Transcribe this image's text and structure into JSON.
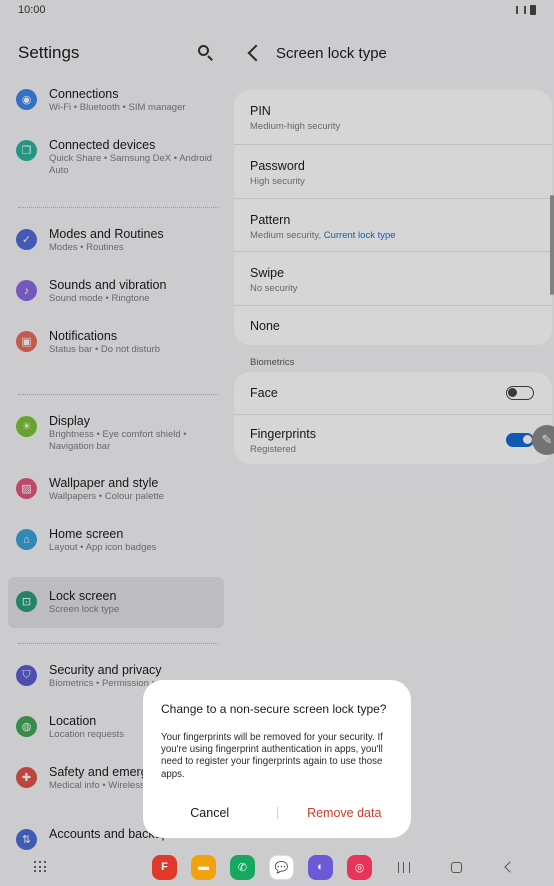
{
  "status_bar": {
    "time": "10:00"
  },
  "settings": {
    "title": "Settings",
    "groups": [
      [
        {
          "title": "Connections",
          "sub": "Wi-Fi  •  Bluetooth  •  SIM manager",
          "icon": "wifi-icon",
          "color": "#3f87e8",
          "glyph": "◉"
        },
        {
          "title": "Connected devices",
          "sub": "Quick Share  •  Samsung DeX  •  Android Auto",
          "icon": "connected-devices-icon",
          "color": "#2bb39b",
          "glyph": "❐"
        }
      ],
      [
        {
          "title": "Modes and Routines",
          "sub": "Modes  •  Routines",
          "icon": "routines-icon",
          "color": "#4f6bd8",
          "glyph": "✓"
        },
        {
          "title": "Sounds and vibration",
          "sub": "Sound mode  •  Ringtone",
          "icon": "speaker-icon",
          "color": "#8a6be0",
          "glyph": "♪"
        },
        {
          "title": "Notifications",
          "sub": "Status bar  •  Do not disturb",
          "icon": "notifications-icon",
          "color": "#ea6b5d",
          "glyph": "▣"
        }
      ],
      [
        {
          "title": "Display",
          "sub": "Brightness  •  Eye comfort shield  •  Navigation bar",
          "icon": "sun-icon",
          "color": "#7ac33a",
          "glyph": "☀"
        },
        {
          "title": "Wallpaper and style",
          "sub": "Wallpapers  •  Colour palette",
          "icon": "wallpaper-icon",
          "color": "#e2577e",
          "glyph": "▨"
        },
        {
          "title": "Home screen",
          "sub": "Layout  •  App icon badges",
          "icon": "home-icon",
          "color": "#3aa3d8",
          "glyph": "⌂"
        },
        {
          "title": "Lock screen",
          "sub": "Screen lock type",
          "icon": "lock-icon",
          "color": "#2b9f7a",
          "glyph": "⊡",
          "active": true
        }
      ],
      [
        {
          "title": "Security and privacy",
          "sub": "Biometrics  •  Permission manager",
          "icon": "shield-icon",
          "color": "#5b5fd0",
          "glyph": "⛉"
        },
        {
          "title": "Location",
          "sub": "Location requests",
          "icon": "location-pin-icon",
          "color": "#43a65a",
          "glyph": "◍"
        },
        {
          "title": "Safety and emerg",
          "sub": "Medical info  •  Wireless alerts",
          "icon": "emergency-icon",
          "color": "#e0534a",
          "glyph": "✚"
        },
        {
          "title": "Accounts and backup",
          "sub": "",
          "icon": "accounts-icon",
          "color": "#4a6fd4",
          "glyph": "⇅"
        }
      ]
    ]
  },
  "lock_type": {
    "title": "Screen lock type",
    "options": [
      {
        "title": "PIN",
        "sub": "Medium-high security"
      },
      {
        "title": "Password",
        "sub": "High security"
      },
      {
        "title": "Pattern",
        "sub": "Medium security, ",
        "highlight": "Current lock type"
      },
      {
        "title": "Swipe",
        "sub": "No security"
      },
      {
        "title": "None",
        "sub": ""
      }
    ],
    "biometrics_label": "Biometrics",
    "biometrics": [
      {
        "title": "Face",
        "sub": "",
        "on": false
      },
      {
        "title": "Fingerprints",
        "sub": "Registered",
        "on": true
      }
    ]
  },
  "dialog": {
    "title": "Change to a non-secure screen lock type?",
    "body": "Your fingerprints will be removed for your security. If you're using fingerprint authentication in apps, you'll need to register your fingerprints again to use those apps.",
    "cancel": "Cancel",
    "confirm": "Remove data"
  },
  "dock": [
    {
      "name": "flipboard",
      "color": "#e2372b",
      "glyph": "F"
    },
    {
      "name": "my-files",
      "color": "#f4a20c",
      "glyph": "▬"
    },
    {
      "name": "phone",
      "color": "#17a860",
      "glyph": "✆"
    },
    {
      "name": "messages",
      "color": "#ffffff",
      "glyph": "💬"
    },
    {
      "name": "internet",
      "color": "#6a5ad8",
      "glyph": "◐"
    },
    {
      "name": "camera",
      "color": "#e8335a",
      "glyph": "◎"
    }
  ]
}
